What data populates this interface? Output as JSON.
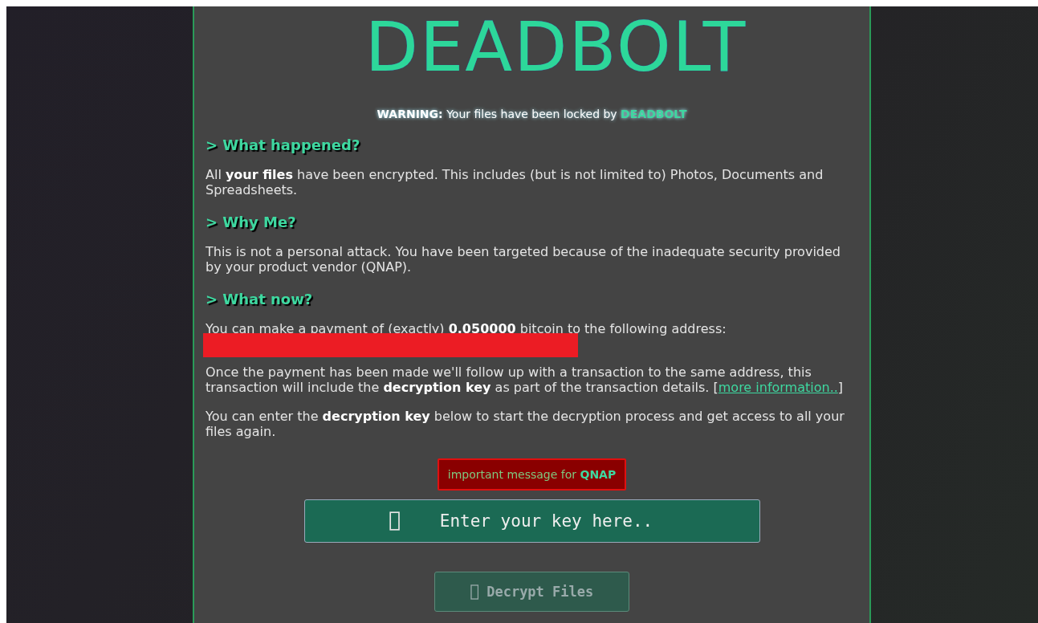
{
  "logo": "DEADBOLT",
  "warning": {
    "label": "WARNING:",
    "text": "Your files have been locked by",
    "brand": "DEADBOLT"
  },
  "sections": [
    {
      "heading": "> What happened?",
      "blocks": [
        {
          "kind": "text",
          "text": "All **your files** have been encrypted. This includes (but is not limited to) Photos, Documents and Spreadsheets."
        }
      ]
    },
    {
      "heading": "> Why Me?",
      "blocks": [
        {
          "kind": "text",
          "text": "This is not a personal attack. You have been targeted because of the inadequate security provided by your product vendor (QNAP)."
        }
      ]
    },
    {
      "heading": "> What now?",
      "blocks": [
        {
          "kind": "text",
          "text": "You can make a payment of (exactly) **0.050000** bitcoin to the following address:"
        },
        {
          "kind": "redacted"
        },
        {
          "kind": "text",
          "text": "Once the payment has been made we'll follow up with a transaction to the same address, this transaction will include the **decryption key** as part of the transaction details. [",
          "link": "more information..",
          "after": "]"
        },
        {
          "kind": "text",
          "text": "You can enter the **decryption key** below to start the decryption process and get access to all your files again."
        }
      ]
    }
  ],
  "message": {
    "text": "important message for",
    "brand": "QNAP"
  },
  "key_field": {
    "placeholder": "Enter your key here.."
  },
  "decrypt_button": {
    "label": "Decrypt Files",
    "disabled": true
  }
}
